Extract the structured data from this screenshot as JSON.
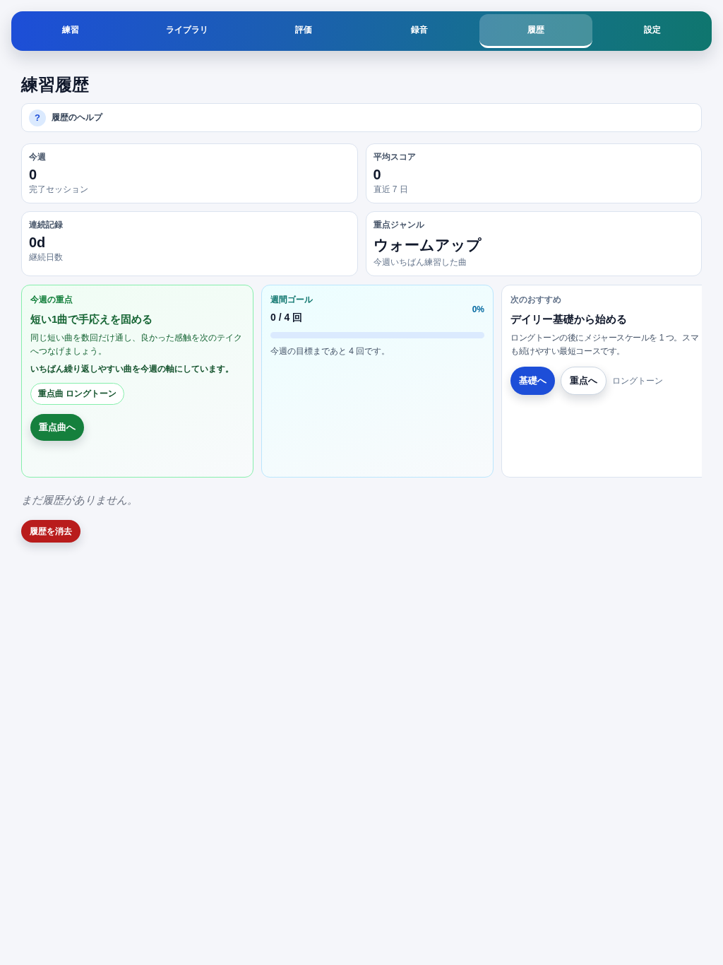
{
  "nav": {
    "tabs": [
      {
        "label": "練習",
        "selected": false
      },
      {
        "label": "ライブラリ",
        "selected": false
      },
      {
        "label": "評価",
        "selected": false
      },
      {
        "label": "録音",
        "selected": false
      },
      {
        "label": "履歴",
        "selected": true
      },
      {
        "label": "設定",
        "selected": false
      }
    ]
  },
  "page": {
    "title": "練習履歴"
  },
  "help": {
    "icon": "?",
    "label": "履歴のヘルプ"
  },
  "stats": [
    {
      "kind": "number",
      "label": "今週",
      "value": "0",
      "caption": "完了セッション"
    },
    {
      "kind": "number",
      "label": "平均スコア",
      "value": "0",
      "caption": "直近 7 日"
    },
    {
      "kind": "number",
      "label": "連続記録",
      "value": "0d",
      "caption": "継続日数"
    },
    {
      "kind": "text",
      "label": "重点ジャンル",
      "value": "ウォームアップ",
      "caption": "今週いちばん練習した曲"
    }
  ],
  "focus_card": {
    "label": "今週の重点",
    "title": "短い1曲で手応えを固める",
    "body": "同じ短い曲を数回だけ通し、良かった感触を次のテイクへつなげましょう。",
    "emphasis": "いちばん繰り返しやすい曲を今週の軸にしています。",
    "chip": "重点曲 ロングトーン",
    "button": "重点曲へ"
  },
  "goal_card": {
    "label": "週間ゴール",
    "count": "0 / 4 回",
    "percent": "0%",
    "level": 0,
    "note": "今週の目標まであと 4 回です。"
  },
  "next_card": {
    "label": "次のおすすめ",
    "title": "デイリー基礎から始める",
    "description_lines": [
      "ロングトーンの後にメジャースケールを 1 つ。スマ",
      "も続けやすい最短コースです。"
    ],
    "buttons": [
      {
        "kind": "primary",
        "label": "基礎へ"
      },
      {
        "kind": "secondary",
        "label": "重点へ"
      }
    ],
    "note": "ロングトーン"
  },
  "history": {
    "empty_message": "まだ履歴がありません。",
    "clear_button": "履歴を消去"
  }
}
